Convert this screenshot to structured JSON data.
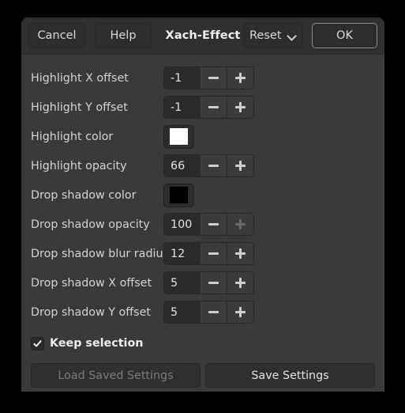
{
  "window": {
    "title": "Xach-Effect"
  },
  "headerbar": {
    "cancel_label": "Cancel",
    "help_label": "Help",
    "reset_label": "Reset",
    "ok_label": "OK",
    "chevron_icon": "chevron-down-icon"
  },
  "rows": [
    {
      "label": "Highlight X offset",
      "kind": "spin",
      "value": "-1",
      "minus_enabled": true,
      "plus_enabled": true
    },
    {
      "label": "Highlight Y offset",
      "kind": "spin",
      "value": "-1",
      "minus_enabled": true,
      "plus_enabled": true
    },
    {
      "label": "Highlight color",
      "kind": "color",
      "value": "#ffffff"
    },
    {
      "label": "Highlight opacity",
      "kind": "spin",
      "value": "66",
      "minus_enabled": true,
      "plus_enabled": true
    },
    {
      "label": "Drop shadow color",
      "kind": "color",
      "value": "#000000"
    },
    {
      "label": "Drop shadow opacity",
      "kind": "spin",
      "value": "100",
      "minus_enabled": true,
      "plus_enabled": false
    },
    {
      "label": "Drop shadow blur radius",
      "kind": "spin",
      "value": "12",
      "minus_enabled": true,
      "plus_enabled": true
    },
    {
      "label": "Drop shadow X offset",
      "kind": "spin",
      "value": "5",
      "minus_enabled": true,
      "plus_enabled": true
    },
    {
      "label": "Drop shadow Y offset",
      "kind": "spin",
      "value": "5",
      "minus_enabled": true,
      "plus_enabled": true
    }
  ],
  "keep_selection": {
    "label": "Keep selection",
    "checked": true,
    "checkbox_icon": "checkmark-icon"
  },
  "footer": {
    "load_label": "Load Saved Settings",
    "load_enabled": false,
    "save_label": "Save Settings",
    "save_enabled": true
  },
  "colors": {
    "window_bg": "#3a3a3a",
    "headerbar_bg": "#303030",
    "button_bg": "#2d2d2d",
    "entry_bg": "#2a2a2a",
    "text": "#d2d2d2",
    "text_disabled": "#7c7c7c",
    "accent_border": "#8c8c8c",
    "desktop_bg": "#000000"
  }
}
